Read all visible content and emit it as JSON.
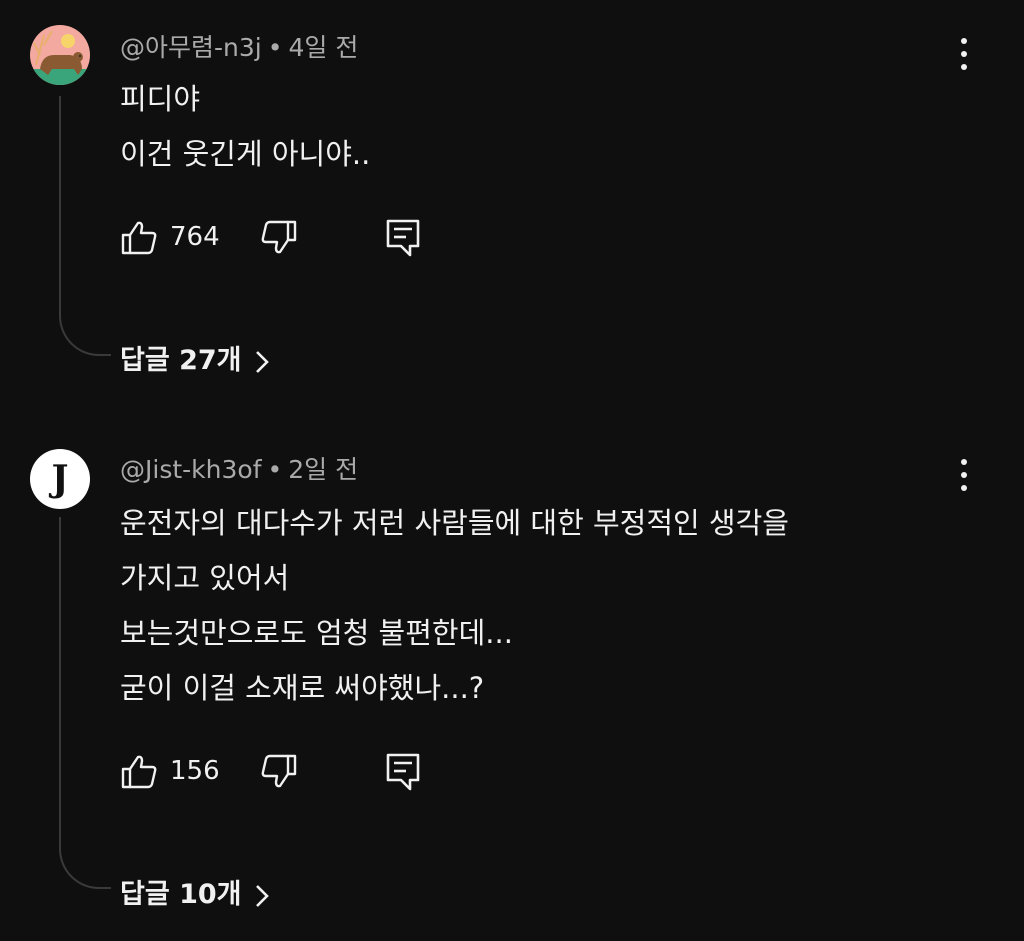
{
  "comments": [
    {
      "author": "@아무렴-n3j",
      "separator": "•",
      "time": "4일 전",
      "avatar_icon": "bear-illustration-avatar",
      "lines": [
        "피디야",
        "이건 웃긴게 아니야.."
      ],
      "likes": "764",
      "replies_label": "답글 27개"
    },
    {
      "author": "@Jist-kh3of",
      "separator": "•",
      "time": "2일 전",
      "avatar_icon": "letter-j-avatar",
      "avatar_letter": "J",
      "lines": [
        "운전자의 대다수가 저런 사람들에 대한 부정적인 생각을",
        "가지고 있어서",
        "보는것만으로도 엄청 불편한데...",
        "굳이 이걸 소재로 써야했나...?"
      ],
      "likes": "156",
      "replies_label": "답글 10개"
    }
  ],
  "icons": {
    "like": "thumbs-up-icon",
    "dislike": "thumbs-down-icon",
    "reply": "comment-reply-icon",
    "more": "more-vert-icon",
    "chevron": "chevron-right-icon"
  },
  "colors": {
    "background": "#0f0f0f",
    "text": "#f1f1f1",
    "meta": "#aaaaaa"
  }
}
